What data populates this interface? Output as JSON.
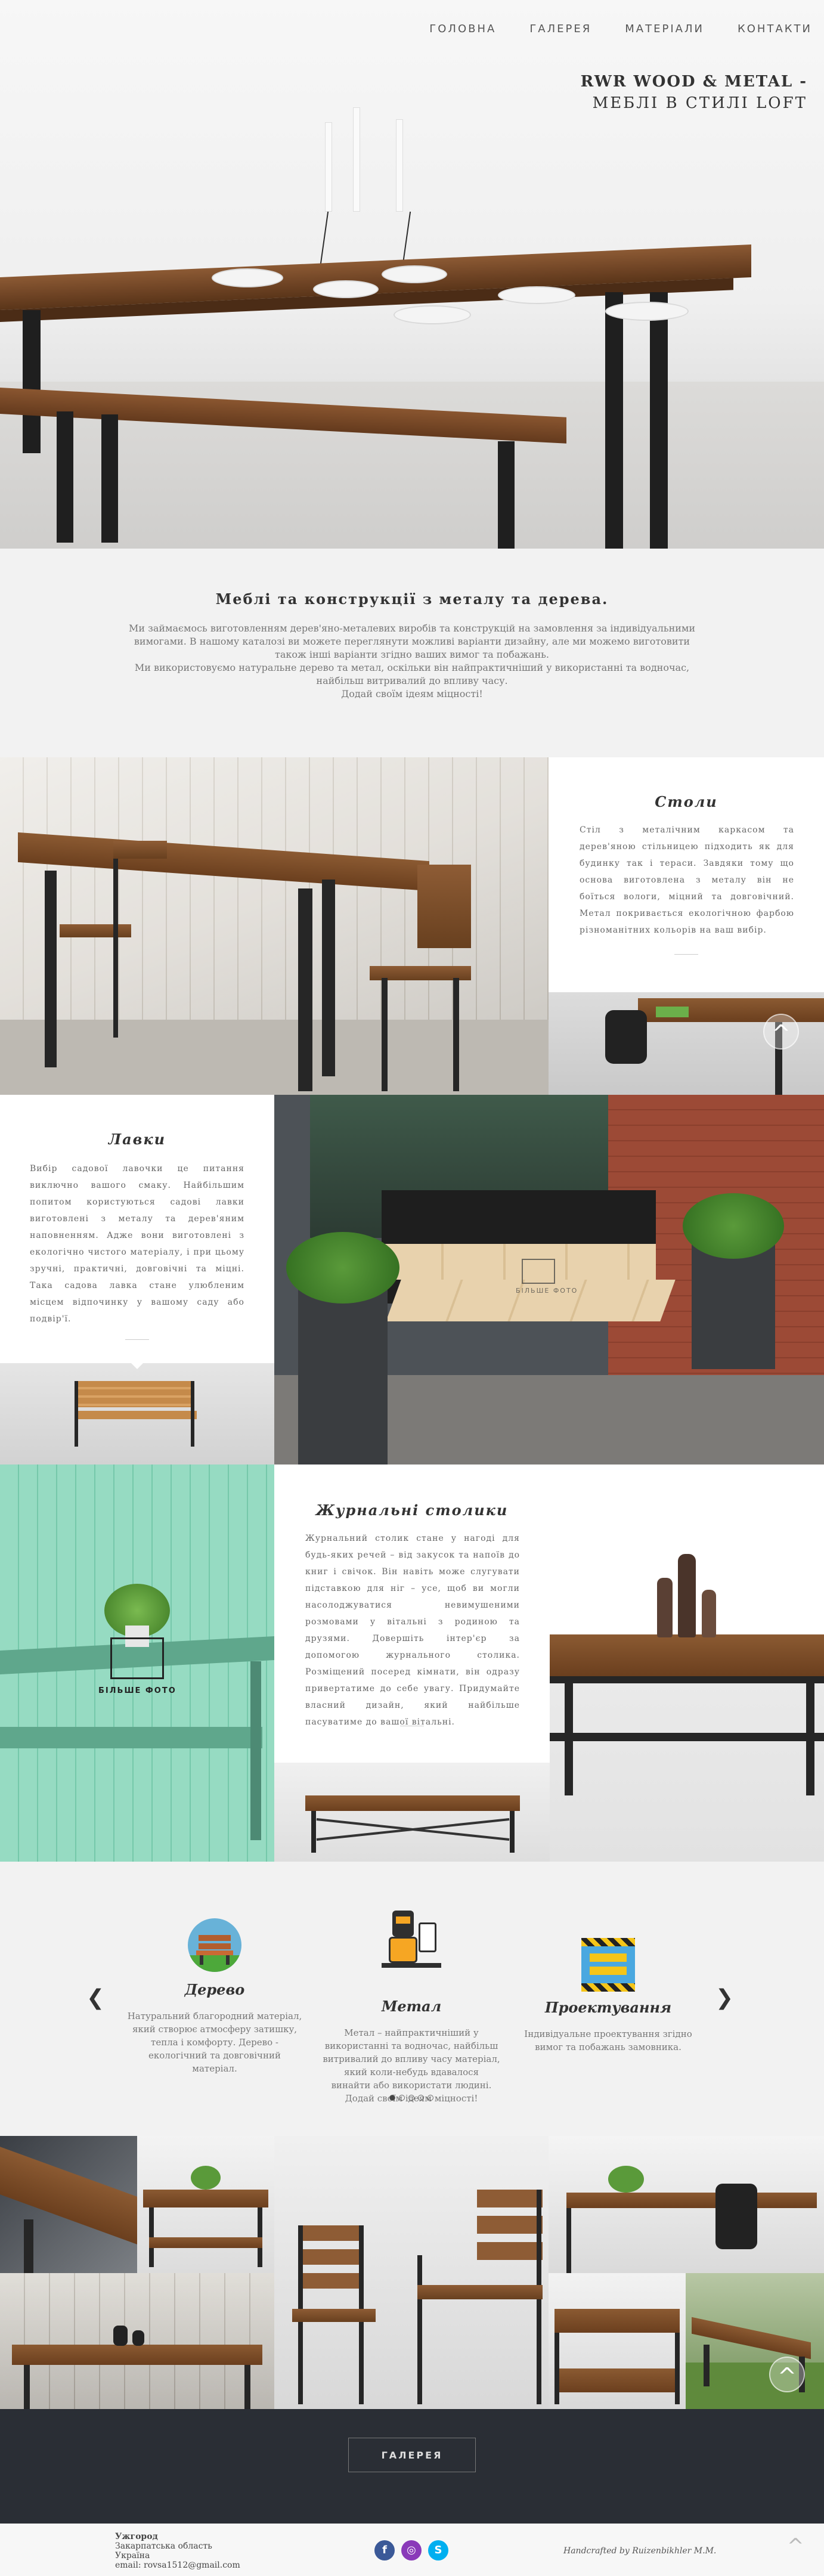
{
  "nav": {
    "items": [
      "ГОЛОВНА",
      "ГАЛЕРЕЯ",
      "МАТЕРІАЛИ",
      "КОНТАКТИ"
    ]
  },
  "hero": {
    "title_line1": "RWR WOOD & METAL -",
    "title_line2": "МЕБЛІ В СТИЛІ LOFT"
  },
  "intro": {
    "heading": "Меблі та конструкції з металу та дерева.",
    "lines": [
      "Ми займаємось виготовленням дерев'яно-металевих виробів та конструкцій на замовлення за індивідуальними",
      "вимогами. В нашому каталозі ви можете переглянути можливі варіанти дизайну, але ми можемо виготовити",
      "також інші варіанти згідно ваших вимог та побажань.",
      "Ми використовуємо натуральне дерево та метал, оскільки він найпрактичніший у використанні та водночас,",
      "найбільш витривалий до впливу часу.",
      "Додай своїм ідеям міцності!"
    ]
  },
  "tables_card": {
    "title": "Столи",
    "text": "Стіл з металічним каркасом та дерев'яною стільницею підходить як для будинку так і тераси. Завдяки тому що основа виготовлена з металу він не боїться вологи, міцний та довговічний. Метал покривається екологічною фарбою різноманітних кольорів на ваш вибір."
  },
  "benches_card": {
    "title": "Лавки",
    "text": "Вибір садової лавочки це питання виключно вашого смаку. Найбільшим попитом користуються садові лавки виготовлені з металу та дерев'яним наповненням. Адже вони виготовлені з екологічно чистого матеріалу, і при цьому зручні, практичні, довговічні та міцні. Така садова лавка стане улюбленим місцем відпочинку у вашому саду або подвір'ї.",
    "watermark": "БІЛЬШЕ ФОТО"
  },
  "coffee_card": {
    "title": "Журнальні столики",
    "text": "Журнальний столик стане у нагоді для будь-яких речей – від закусок та напоїв до книг і свічок. Він навіть може слугувати підставкою для ніг – усе, щоб ви могли насолоджуватися невимушеними розмовами у вітальні з родиною та друзями. Довершіть інтер'єр за допомогою журнального столика. Розміщений посеред кімнати, він одразу привертатиме до себе увагу. Придумайте власний дизайн, який найбільше пасуватиме до вашої вітальні.",
    "more_photos": "БІЛЬШЕ ФОТО"
  },
  "features": {
    "items": [
      {
        "title": "Дерево",
        "text": [
          "Натуральний благородний матеріал,",
          "який створює атмосферу затишку,",
          "тепла і комфорту. Дерево -",
          "екологічний та довговічний",
          "матеріал."
        ]
      },
      {
        "title": "Метал",
        "text": [
          "Метал – найпрактичніший у",
          "використанні та водночас, найбільш",
          "витривалий до впливу часу матеріал,",
          "який коли-небудь вдавалося",
          "винайти або використати людині.",
          "Додай своїм ідеям міцності!"
        ]
      },
      {
        "title": "Проектування",
        "text": [
          "Індивідуальне проектування згідно",
          "вимог та побажань замовника."
        ]
      }
    ],
    "prev_arrow": "❮",
    "next_arrow": "❯",
    "dots": 5
  },
  "gallery": {
    "button_label": "ГАЛЕРЕЯ"
  },
  "footer": {
    "city": "Ужгород",
    "region": "Закарпатська область",
    "country": "Україна",
    "email": "email: rovsa1512@gmail.com",
    "handcrafted": "Handcrafted by Ruizenbikhler M.M."
  },
  "ui": {
    "scroll_top_glyph": "^"
  },
  "colors": {
    "facebook": "#3b5998",
    "instagram": "#8a3ab9",
    "skype": "#00aff0",
    "footer_band": "#2a2e35",
    "mint": "#7fd3b5"
  }
}
